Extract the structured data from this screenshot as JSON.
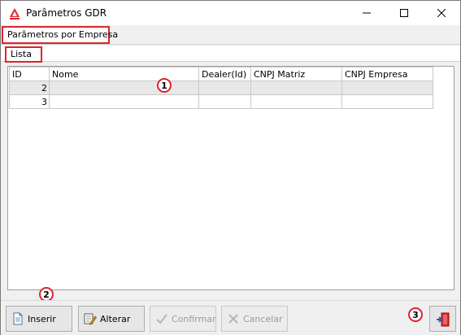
{
  "window": {
    "title": "Parâmetros GDR"
  },
  "tabs": {
    "main": "Parâmetros por Empresa",
    "sub": "Lista"
  },
  "grid": {
    "columns": [
      "ID",
      "Nome",
      "Dealer(Id)",
      "CNPJ Matriz",
      "CNPJ Empresa"
    ],
    "rows": [
      {
        "id": "2",
        "nome": "",
        "dealer": "",
        "cnpj_matriz": "",
        "cnpj_empresa": ""
      },
      {
        "id": "3",
        "nome": "",
        "dealer": "",
        "cnpj_matriz": "",
        "cnpj_empresa": ""
      }
    ]
  },
  "buttons": {
    "inserir": "Inserir",
    "alterar": "Alterar",
    "confirmar": "Confirmar",
    "cancelar": "Cancelar"
  },
  "annotations": {
    "one": "1",
    "two": "2",
    "three": "3"
  },
  "icons": {
    "app": "app-logo-icon",
    "minimize": "minimize-icon",
    "maximize": "maximize-icon",
    "close": "close-icon",
    "inserir": "new-document-icon",
    "alterar": "edit-icon",
    "confirmar": "check-icon",
    "cancelar": "cancel-x-icon",
    "sair": "exit-door-icon"
  },
  "colors": {
    "highlight": "#d9262c",
    "window_bg": "#f0f0f0"
  }
}
